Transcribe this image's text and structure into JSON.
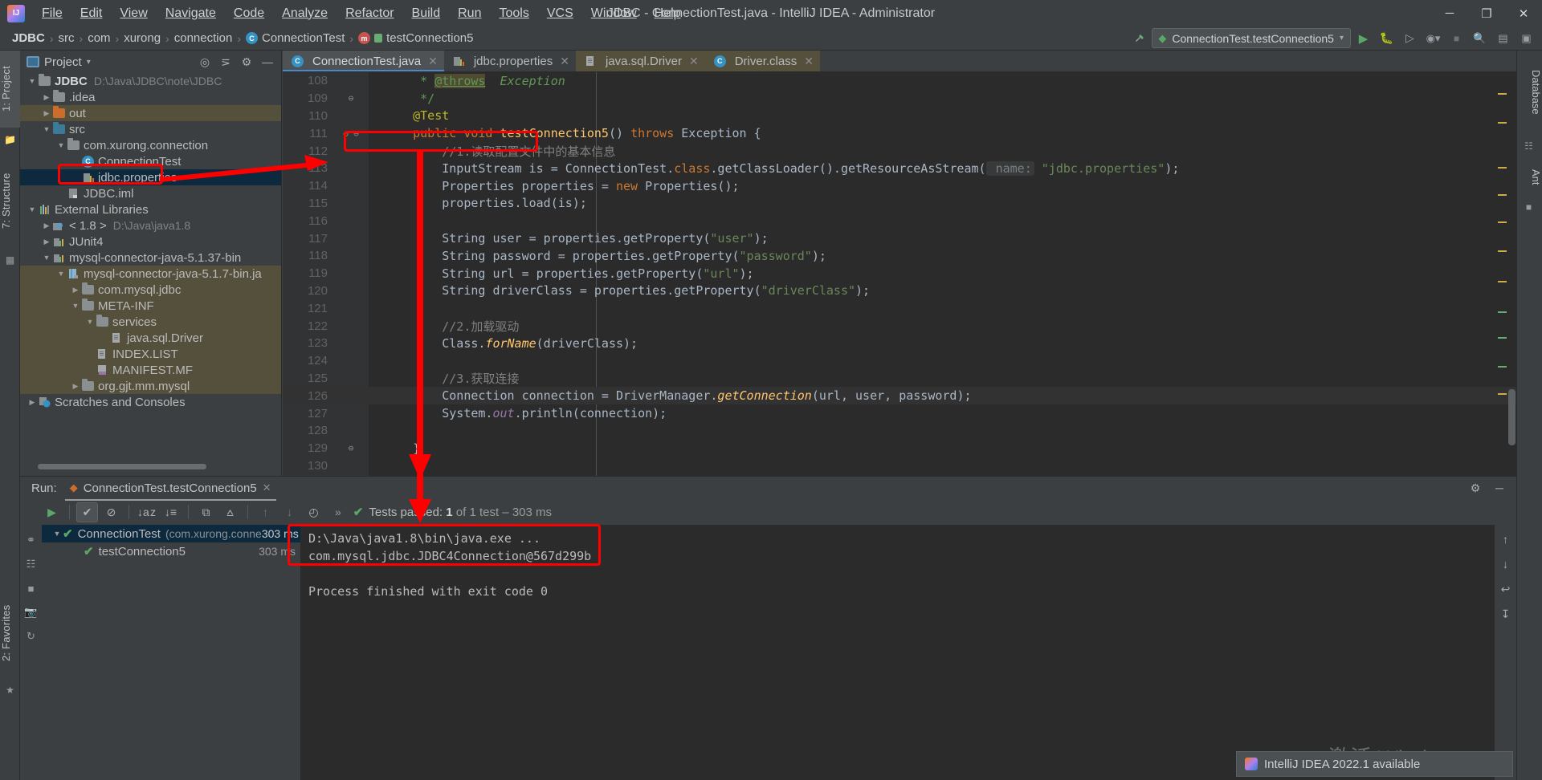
{
  "window": {
    "title": "JDBC - ConnectionTest.java - IntelliJ IDEA - Administrator",
    "minimize": "─",
    "maximize": "❐",
    "close": "✕"
  },
  "menu": {
    "items": [
      "File",
      "Edit",
      "View",
      "Navigate",
      "Code",
      "Analyze",
      "Refactor",
      "Build",
      "Run",
      "Tools",
      "VCS",
      "Window",
      "Help"
    ]
  },
  "breadcrumb": {
    "items": [
      "JDBC",
      "src",
      "com",
      "xurong",
      "connection",
      "ConnectionTest",
      "testConnection5"
    ],
    "separator": "›"
  },
  "navbar": {
    "run_config": "ConnectionTest.testConnection5",
    "dropdown_caret": "▾",
    "icons": [
      "build-icon",
      "run-icon",
      "debug-icon",
      "run-coverage-icon",
      "profiler-icon",
      "stop-icon",
      "search-everywhere-icon",
      "settings-icon",
      "project-structure-icon"
    ]
  },
  "left_rail": {
    "project_tab": "1: Project",
    "structure_tab": "7: Structure",
    "favorites_tab": "2: Favorites"
  },
  "right_rail": {
    "database_tab": "Database",
    "ant_tab": "Ant"
  },
  "project_panel": {
    "title": "Project",
    "caret": "▾",
    "tools": [
      "locate-icon",
      "collapse-all-icon",
      "settings-icon",
      "hide-icon"
    ],
    "tree": [
      {
        "depth": 0,
        "twisty": "▼",
        "icon": "module-folder-icon",
        "label": "JDBC",
        "path": "D:\\Java\\JDBC\\note\\JDBC",
        "bold": true,
        "state": "normal"
      },
      {
        "depth": 1,
        "twisty": "▶",
        "icon": "folder-icon",
        "label": ".idea",
        "path": "",
        "bold": false,
        "state": "normal"
      },
      {
        "depth": 1,
        "twisty": "▶",
        "icon": "folder-orange-icon",
        "label": "out",
        "path": "",
        "bold": false,
        "state": "highlight"
      },
      {
        "depth": 1,
        "twisty": "▼",
        "icon": "source-folder-icon",
        "label": "src",
        "path": "",
        "bold": false,
        "state": "normal"
      },
      {
        "depth": 2,
        "twisty": "▼",
        "icon": "package-icon",
        "label": "com.xurong.connection",
        "path": "",
        "bold": false,
        "state": "normal"
      },
      {
        "depth": 3,
        "twisty": "",
        "icon": "java-class-test-icon",
        "label": "ConnectionTest",
        "path": "",
        "bold": false,
        "state": "normal"
      },
      {
        "depth": 3,
        "twisty": "",
        "icon": "properties-file-icon",
        "label": "jdbc.properties",
        "path": "",
        "bold": false,
        "state": "selected"
      },
      {
        "depth": 2,
        "twisty": "",
        "icon": "iml-file-icon",
        "label": "JDBC.iml",
        "path": "",
        "bold": false,
        "state": "normal"
      },
      {
        "depth": 0,
        "twisty": "▼",
        "icon": "external-libraries-icon",
        "label": "External Libraries",
        "path": "",
        "bold": false,
        "state": "normal"
      },
      {
        "depth": 1,
        "twisty": "▶",
        "icon": "jdk-icon",
        "label": "< 1.8 >",
        "path": "D:\\Java\\java1.8",
        "bold": false,
        "state": "normal"
      },
      {
        "depth": 1,
        "twisty": "▶",
        "icon": "library-icon",
        "label": "JUnit4",
        "path": "",
        "bold": false,
        "state": "normal"
      },
      {
        "depth": 1,
        "twisty": "▼",
        "icon": "library-icon",
        "label": "mysql-connector-java-5.1.37-bin",
        "path": "",
        "bold": false,
        "state": "normal"
      },
      {
        "depth": 2,
        "twisty": "▼",
        "icon": "jar-icon",
        "label": "mysql-connector-java-5.1.7-bin.ja",
        "path": "",
        "bold": false,
        "state": "highlight"
      },
      {
        "depth": 3,
        "twisty": "▶",
        "icon": "folder-icon",
        "label": "com.mysql.jdbc",
        "path": "",
        "bold": false,
        "state": "highlight"
      },
      {
        "depth": 3,
        "twisty": "▼",
        "icon": "folder-icon",
        "label": "META-INF",
        "path": "",
        "bold": false,
        "state": "highlight"
      },
      {
        "depth": 4,
        "twisty": "▼",
        "icon": "folder-icon",
        "label": "services",
        "path": "",
        "bold": false,
        "state": "highlight"
      },
      {
        "depth": 5,
        "twisty": "",
        "icon": "file-icon",
        "label": "java.sql.Driver",
        "path": "",
        "bold": false,
        "state": "highlight"
      },
      {
        "depth": 4,
        "twisty": "",
        "icon": "file-icon",
        "label": "INDEX.LIST",
        "path": "",
        "bold": false,
        "state": "highlight"
      },
      {
        "depth": 4,
        "twisty": "",
        "icon": "manifest-file-icon",
        "label": "MANIFEST.MF",
        "path": "",
        "bold": false,
        "state": "highlight"
      },
      {
        "depth": 3,
        "twisty": "▶",
        "icon": "folder-icon",
        "label": "org.gjt.mm.mysql",
        "path": "",
        "bold": false,
        "state": "highlight"
      },
      {
        "depth": 0,
        "twisty": "▶",
        "icon": "scratches-icon",
        "label": "Scratches and Consoles",
        "path": "",
        "bold": false,
        "state": "normal"
      }
    ]
  },
  "editor": {
    "tabs": [
      {
        "label": "ConnectionTest.java",
        "icon": "java-class-test-icon",
        "active": true,
        "highlight": false
      },
      {
        "label": "jdbc.properties",
        "icon": "properties-file-icon",
        "active": false,
        "highlight": false
      },
      {
        "label": "java.sql.Driver",
        "icon": "file-icon",
        "active": false,
        "highlight": true
      },
      {
        "label": "Driver.class",
        "icon": "java-class-icon",
        "active": false,
        "highlight": true
      }
    ],
    "close_glyph": "✕",
    "lines": [
      {
        "no": "108",
        "html": "     <span class='doc'>* </span><span class='doctag'>@throws</span><span class='doc fi'>  Exception</span>",
        "gutter": "",
        "fold": "",
        "current": false
      },
      {
        "no": "109",
        "html": "     <span class='doc'>*/</span>",
        "gutter": "",
        "fold": "⊖",
        "current": false
      },
      {
        "no": "110",
        "html": "    <span class='an'>@Test</span>",
        "gutter": "",
        "fold": "",
        "current": false
      },
      {
        "no": "111",
        "html": "    <span class='k'>public void </span><span class='m'>testConnection5</span><span class='t'>() </span><span class='k'>throws </span><span class='t'>Exception {</span>",
        "gutter": "run-test-icon",
        "fold": "⊖",
        "current": false
      },
      {
        "no": "112",
        "html": "        <span class='c'>//1.读取配置文件中的基本信息</span>",
        "gutter": "",
        "fold": "",
        "current": false
      },
      {
        "no": "113",
        "html": "        <span class='t'>InputStream is = ConnectionTest.</span><span class='k'>class</span><span class='t'>.getClassLoader().getResourceAsStream(</span><span class='hint'> name:</span><span class='t'> </span><span class='s'>\"jdbc.properties\"</span><span class='t'>);</span>",
        "gutter": "",
        "fold": "",
        "current": false
      },
      {
        "no": "114",
        "html": "        <span class='t'>Properties properties = </span><span class='k'>new </span><span class='t'>Properties();</span>",
        "gutter": "",
        "fold": "",
        "current": false
      },
      {
        "no": "115",
        "html": "        <span class='t'>properties.load(is);</span>",
        "gutter": "",
        "fold": "",
        "current": false
      },
      {
        "no": "116",
        "html": "",
        "gutter": "",
        "fold": "",
        "current": false
      },
      {
        "no": "117",
        "html": "        <span class='t'>String user = properties.getProperty(</span><span class='s'>\"user\"</span><span class='t'>);</span>",
        "gutter": "",
        "fold": "",
        "current": false
      },
      {
        "no": "118",
        "html": "        <span class='t'>String password = properties.getProperty(</span><span class='s'>\"password\"</span><span class='t'>);</span>",
        "gutter": "",
        "fold": "",
        "current": false
      },
      {
        "no": "119",
        "html": "        <span class='t'>String url = properties.getProperty(</span><span class='s'>\"url\"</span><span class='t'>);</span>",
        "gutter": "",
        "fold": "",
        "current": false
      },
      {
        "no": "120",
        "html": "        <span class='t'>String driverClass = properties.getProperty(</span><span class='s'>\"driverClass\"</span><span class='t'>);</span>",
        "gutter": "",
        "fold": "",
        "current": false
      },
      {
        "no": "121",
        "html": "",
        "gutter": "",
        "fold": "",
        "current": false
      },
      {
        "no": "122",
        "html": "        <span class='c'>//2.加载驱动</span>",
        "gutter": "",
        "fold": "",
        "current": false
      },
      {
        "no": "123",
        "html": "        <span class='t'>Class.</span><span class='m fi'>forName</span><span class='t'>(driverClass);</span>",
        "gutter": "",
        "fold": "",
        "current": false
      },
      {
        "no": "124",
        "html": "",
        "gutter": "",
        "fold": "",
        "current": false
      },
      {
        "no": "125",
        "html": "        <span class='c'>//3.获取连接</span>",
        "gutter": "",
        "fold": "",
        "current": false
      },
      {
        "no": "126",
        "html": "        <span class='t'>Connection connection = DriverManager.</span><span class='m fi'>getConnection</span><span class='t'>(url, user, password);</span>",
        "gutter": "",
        "fold": "",
        "current": true
      },
      {
        "no": "127",
        "html": "        <span class='t'>System.</span><span class='f fi'>out</span><span class='t'>.println(connection);</span>",
        "gutter": "",
        "fold": "",
        "current": false
      },
      {
        "no": "128",
        "html": "",
        "gutter": "",
        "fold": "",
        "current": false
      },
      {
        "no": "129",
        "html": "    <span class='t'>}</span>",
        "gutter": "",
        "fold": "⊖",
        "current": false
      },
      {
        "no": "130",
        "html": "",
        "gutter": "",
        "fold": "",
        "current": false
      },
      {
        "no": "131",
        "html": "<span class='t'>}</span>",
        "gutter": "",
        "fold": "",
        "current": false
      }
    ]
  },
  "run_panel": {
    "label": "Run:",
    "tab_title": "ConnectionTest.testConnection5",
    "tab_close": "✕",
    "toolbar": [
      {
        "name": "rerun-button",
        "glyph": "▶",
        "state": "active"
      },
      {
        "name": "show-passed-toggle",
        "glyph": "✔",
        "state": "on"
      },
      {
        "name": "hide-ignored-toggle",
        "glyph": "⊘",
        "state": "normal"
      },
      {
        "name": "sort-alphabetically-button",
        "glyph": "↓a z",
        "state": "normal"
      },
      {
        "name": "sort-by-duration-button",
        "glyph": "↓≡",
        "state": "normal"
      },
      {
        "name": "expand-all-button",
        "glyph": "⧉",
        "state": "normal"
      },
      {
        "name": "collapse-all-button",
        "glyph": "⩟",
        "state": "normal"
      },
      {
        "name": "previous-failed-button",
        "glyph": "↑",
        "state": "dim"
      },
      {
        "name": "next-failed-button",
        "glyph": "↓",
        "state": "dim"
      },
      {
        "name": "test-history-button",
        "glyph": "◴",
        "state": "normal"
      }
    ],
    "overflow_glyph": "»",
    "status_check": "✔",
    "status_prefix": "Tests passed: ",
    "status_count": "1",
    "status_suffix": " of 1 test – 303 ms",
    "tree": [
      {
        "depth": 0,
        "twisty": "▼",
        "check": "✔",
        "label": "ConnectionTest",
        "sub": "(com.xurong.conne",
        "time": "303 ms",
        "selected": true
      },
      {
        "depth": 1,
        "twisty": "",
        "check": "✔",
        "label": "testConnection5",
        "sub": "",
        "time": "303 ms",
        "selected": false
      }
    ],
    "console": [
      "D:\\Java\\java1.8\\bin\\java.exe ...",
      "com.mysql.jdbc.JDBC4Connection@567d299b",
      "",
      "Process finished with exit code 0"
    ],
    "rail_icons": [
      "debugger-icon",
      "console-icon",
      "stop-icon",
      "screenshot-icon",
      "rerun-icon",
      "pin-icon"
    ],
    "console_rail_icons": [
      "scroll-up-icon",
      "scroll-down-icon",
      "soft-wrap-icon",
      "print-icon",
      "clear-all-icon"
    ],
    "settings_glyph": "⚙",
    "hide_glyph": "─"
  },
  "toast": {
    "text": "IntelliJ IDEA 2022.1 available",
    "icon": "idea-update-icon"
  },
  "watermark": {
    "line1": "激活 Windows",
    "line2": ""
  },
  "annotations": {
    "box_properties_label": "jdbc.properties-highlight",
    "box_comment_label": "code-comment-highlight",
    "box_console_label": "console-output-highlight",
    "arrow_color": "#ff0000"
  },
  "colors": {
    "accent_blue": "#4a88c7",
    "selection": "#0d293e",
    "highlight_olive": "#55503c",
    "editor_bg": "#2b2b2b",
    "panel_bg": "#3c3f41",
    "green_pass": "#59a869",
    "annotation_red": "#ff0000"
  }
}
